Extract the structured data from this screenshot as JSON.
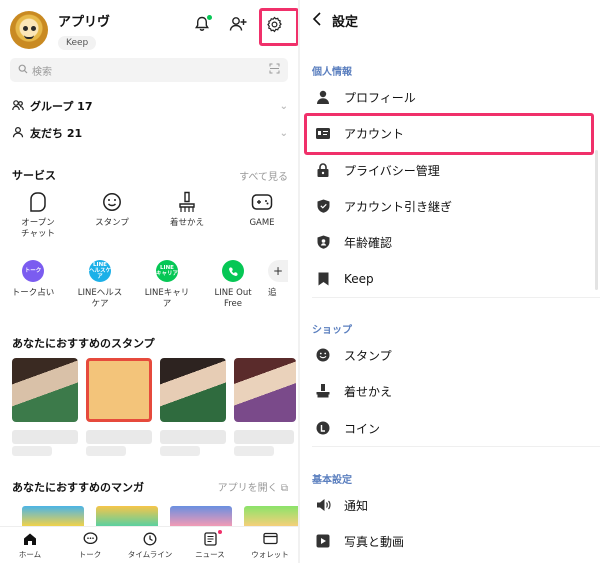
{
  "left": {
    "profile": {
      "name": "アプリヴ",
      "badge": "Keep"
    },
    "search_placeholder": "検索",
    "groups": {
      "label": "グループ 17"
    },
    "friends": {
      "label": "友だち 21"
    },
    "services": {
      "title": "サービス",
      "see_all": "すべて見る",
      "items": [
        {
          "label": "オープン\nチャット",
          "icon": "open-chat-icon"
        },
        {
          "label": "スタンプ",
          "icon": "sticker-icon"
        },
        {
          "label": "着せかえ",
          "icon": "theme-icon"
        },
        {
          "label": "GAME",
          "icon": "game-icon"
        }
      ],
      "items2": [
        {
          "label": "トーク占い",
          "badge": "トーク",
          "color": "#7b5cf0"
        },
        {
          "label": "LINEヘルス\nケア",
          "badge": "LINE\nヘルスケア",
          "color": "#1cb0e8"
        },
        {
          "label": "LINEキャリ\nア",
          "badge": "LINE\nキャリア",
          "color": "#06c755"
        },
        {
          "label": "LINE Out\nFree",
          "badge": "",
          "color": "#06c755"
        }
      ],
      "more_label": "追"
    },
    "stickers": {
      "title": "あなたにおすすめのスタンプ"
    },
    "manga": {
      "title": "あなたにおすすめのマンガ",
      "open_app": "アプリを開く"
    },
    "tabs": [
      {
        "label": "ホーム",
        "icon": "home-icon"
      },
      {
        "label": "トーク",
        "icon": "talk-icon"
      },
      {
        "label": "タイムライン",
        "icon": "timeline-icon"
      },
      {
        "label": "ニュース",
        "icon": "news-icon"
      },
      {
        "label": "ウォレット",
        "icon": "wallet-icon"
      }
    ]
  },
  "right": {
    "title": "設定",
    "sections": [
      {
        "title": "個人情報"
      },
      {
        "title": "ショップ"
      },
      {
        "title": "基本設定"
      }
    ],
    "items": [
      {
        "label": "プロフィール",
        "icon": "person-icon"
      },
      {
        "label": "アカウント",
        "icon": "id-card-icon"
      },
      {
        "label": "プライバシー管理",
        "icon": "lock-icon"
      },
      {
        "label": "アカウント引き継ぎ",
        "icon": "shield-icon"
      },
      {
        "label": "年齢確認",
        "icon": "age-shield-icon"
      },
      {
        "label": "Keep",
        "icon": "bookmark-icon"
      },
      {
        "label": "スタンプ",
        "icon": "smiley-icon"
      },
      {
        "label": "着せかえ",
        "icon": "brush-icon"
      },
      {
        "label": "コイン",
        "icon": "coin-icon"
      },
      {
        "label": "通知",
        "icon": "speaker-icon"
      },
      {
        "label": "写真と動画",
        "icon": "play-icon"
      }
    ]
  },
  "colors": {
    "highlight": "#f0306a",
    "line_green": "#06c755",
    "section_blue": "#5b7fbf"
  }
}
